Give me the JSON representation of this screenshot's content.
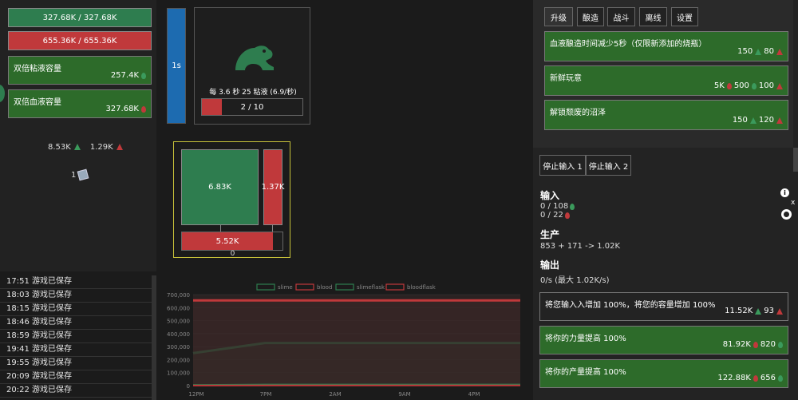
{
  "left": {
    "slime_bar": "327.68K / 327.68K",
    "blood_bar": "655.36K / 655.36K",
    "upgrades": [
      {
        "label": "双倍粘液容量",
        "value": "257.4K",
        "icon": "slime-drop-icon"
      },
      {
        "label": "双倍血液容量",
        "value": "327.68K",
        "icon": "blood-drop-icon"
      }
    ],
    "flasks": {
      "slimeflask": "8.53K",
      "bloodflask": "1.29K"
    },
    "item_count": "1"
  },
  "center": {
    "timer_label": "1s",
    "production_text": "每 3.6 秒 25 粘液 (6.9/秒)",
    "progress_text": "2 / 10",
    "progress_fraction": 0.2,
    "squares": {
      "green": "6.83K",
      "red": "1.37K",
      "bottom": "5.52K",
      "zero": "0"
    }
  },
  "log": [
    "17:51 游戏已保存",
    "18:03 游戏已保存",
    "18:15 游戏已保存",
    "18:46 游戏已保存",
    "18:59 游戏已保存",
    "19:41 游戏已保存",
    "19:55 游戏已保存",
    "20:09 游戏已保存",
    "20:22 游戏已保存"
  ],
  "chart_data": {
    "type": "line",
    "legend": [
      "slime",
      "blood",
      "slimeflask",
      "bloodflask"
    ],
    "colors": [
      "#2e7d4f",
      "#c0393b",
      "#2e7d4f",
      "#c0393b"
    ],
    "x": [
      "12PM",
      "7PM",
      "2AM",
      "9AM",
      "4PM"
    ],
    "yticks": [
      "700,000",
      "600,000",
      "500,000",
      "400,000",
      "300,000",
      "200,000",
      "100,000",
      "0"
    ],
    "ylim": [
      0,
      700000
    ],
    "series": [
      {
        "name": "slime",
        "values": [
          250000,
          327680,
          327680,
          327680,
          327680,
          327680
        ]
      },
      {
        "name": "blood",
        "values": [
          655360,
          655360,
          655360,
          655360,
          655360,
          655360
        ]
      },
      {
        "name": "slimeflask",
        "values": [
          5000,
          8530,
          8530,
          8530,
          8530,
          8530
        ]
      },
      {
        "name": "bloodflask",
        "values": [
          1000,
          1290,
          1290,
          1290,
          1290,
          1290
        ]
      }
    ]
  },
  "right": {
    "tabs": [
      "升级",
      "酿造",
      "战斗",
      "离线",
      "设置"
    ],
    "upgrades": [
      {
        "title": "血液酿造时间减少5秒（仅限新添加的烧瓶）",
        "cost": [
          "150",
          "80"
        ]
      },
      {
        "title": "新鲜玩意",
        "cost": [
          "5K",
          "500",
          "100"
        ]
      },
      {
        "title": "解锁颓废的沼泽",
        "cost": [
          "150",
          "120"
        ]
      }
    ],
    "stop_buttons": [
      "停止输入 1",
      "停止输入 2"
    ],
    "input_heading": "输入",
    "inputs": [
      "0 / 108",
      "0 / 22"
    ],
    "production_heading": "生产",
    "production": "853 + 171 -> 1.02K",
    "output_heading": "输出",
    "output": "0/s (最大 1.02K/s)",
    "bottom_cards": [
      {
        "title": "将您输入入增加 100%，将您的容量增加 100%",
        "cost": [
          "11.52K",
          "93"
        ]
      },
      {
        "title": "将你的力量提高 100%",
        "cost": [
          "81.92K",
          "820"
        ]
      },
      {
        "title": "将你的产量提高 100%",
        "cost": [
          "122.88K",
          "656"
        ]
      }
    ]
  }
}
